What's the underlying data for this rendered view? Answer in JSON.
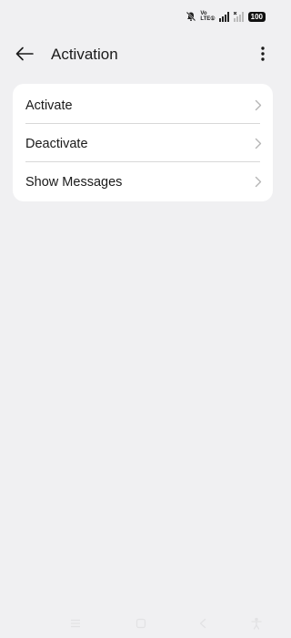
{
  "status_bar": {
    "volte_top": "Vo",
    "volte_bottom": "LTE①",
    "battery": "100",
    "icons": [
      "mute-notification-icon",
      "volte-icon",
      "signal-icon",
      "no-signal-icon",
      "battery-icon"
    ]
  },
  "header": {
    "title": "Activation",
    "back_icon": "arrow-left-icon",
    "more_icon": "more-vertical-icon"
  },
  "menu": {
    "items": [
      {
        "label": "Activate"
      },
      {
        "label": "Deactivate"
      },
      {
        "label": "Show Messages"
      }
    ],
    "chevron_icon": "chevron-right-icon"
  },
  "nav_bar": {
    "icons": [
      "menu-icon",
      "home-icon",
      "back-icon",
      "accessibility-icon"
    ]
  },
  "colors": {
    "background": "#f0f0f2",
    "card": "#ffffff",
    "text": "#1a1a1a",
    "divider": "#d8d8d8",
    "chevron": "#b5b5b5"
  }
}
